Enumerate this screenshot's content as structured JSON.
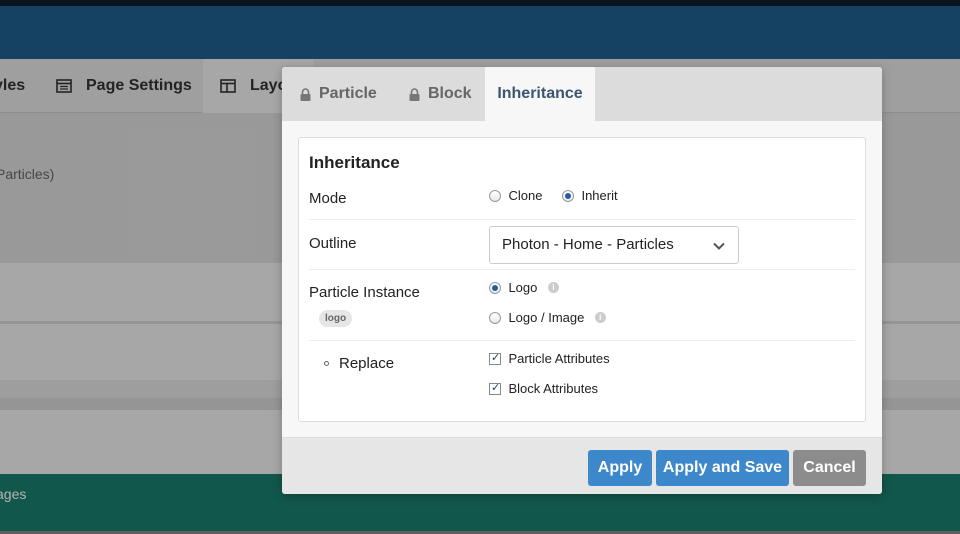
{
  "background": {
    "tabs": {
      "styles_partial": "yles",
      "page_settings": "Page Settings",
      "layout_partial": "Layo"
    },
    "subtext_partial": "Particles)",
    "footer_partial": "ages"
  },
  "modal": {
    "tabs": {
      "particle": "Particle",
      "block": "Block",
      "inheritance": "Inheritance"
    },
    "panel_title": "Inheritance",
    "mode": {
      "label": "Mode",
      "options": {
        "clone": "Clone",
        "inherit": "Inherit"
      },
      "selected": "Inherit"
    },
    "outline": {
      "label": "Outline",
      "value": "Photon - Home - Particles"
    },
    "particle_instance": {
      "label": "Particle Instance",
      "badge": "logo",
      "options": {
        "logo": "Logo",
        "logo_image": "Logo / Image"
      },
      "selected": "Logo"
    },
    "replace": {
      "label": "Replace",
      "options": {
        "particle_attributes": "Particle Attributes",
        "block_attributes": "Block Attributes"
      }
    },
    "buttons": {
      "apply": "Apply",
      "apply_save": "Apply and Save",
      "cancel": "Cancel"
    }
  },
  "colors": {
    "header": "#1f5d8e",
    "footer": "#1a7d6c",
    "primary_button": "#3d87cb",
    "cancel_button": "#8c8c8c",
    "active_tab_text": "#3c5570"
  }
}
